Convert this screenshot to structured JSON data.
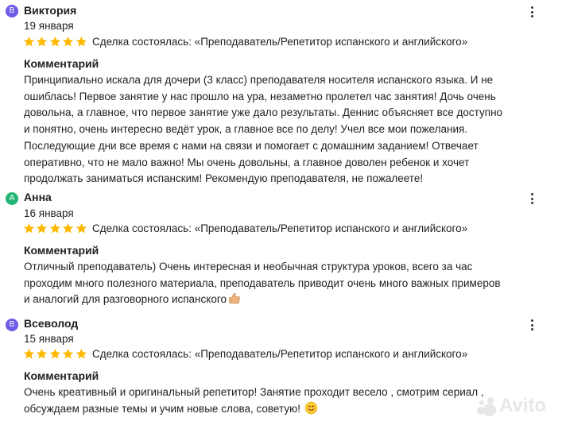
{
  "colors": {
    "star": "#ffb800",
    "avatar_purple": "#6c5ce7",
    "avatar_green": "#22b573"
  },
  "reviews": [
    {
      "initial": "В",
      "name": "Виктория",
      "date": "19 января",
      "rating": 5,
      "deal": "Сделка состоялась: «Преподаватель/Репетитор испанского и английского»",
      "comment_title": "Комментарий",
      "comment_lines": [
        "Принципиально искала для дочери (3 класс) преподавателя носителя испанского языка. И не",
        "ошиблась! Первое занятие у нас прошло на ура, незаметно пролетел час занятия! Дочь очень",
        "довольна, а главное, что первое занятие уже дало результаты. Деннис объясняет все доступно",
        "и понятно, очень интересно ведёт урок, а главное все по делу! Учел все мои пожелания.",
        "Последующие дни все время с нами на связи и помогает с домашним заданием! Отвечает",
        "оперативно, что не мало важно! Мы очень довольны, а главное доволен ребенок и хочет",
        "продолжать заниматься испанским! Рекомендую преподавателя, не пожалеете!"
      ]
    },
    {
      "initial": "А",
      "name": "Анна",
      "date": "16 января",
      "rating": 5,
      "deal": "Сделка состоялась: «Преподаватель/Репетитор испанского и английского»",
      "comment_title": "Комментарий",
      "comment_lines": [
        "Отличный преподаватель) Очень интересная и необычная структура уроков, всего за час",
        "проходим много полезного материала, преподаватель приводит очень много важных примеров",
        "и аналогий для разговорного испанского"
      ],
      "emoji": "👍🏼"
    },
    {
      "initial": "В",
      "name": "Всеволод",
      "date": "15 января",
      "rating": 5,
      "deal": "Сделка состоялась: «Преподаватель/Репетитор испанского и английского»",
      "comment_title": "Комментарий",
      "comment_lines": [
        "Очень креативный и оригинальный репетитор! Занятие проходит весело , смотрим сериал ,",
        "обсуждаем разные темы и учим новые слова, советую!"
      ],
      "emoji": "😊"
    }
  ],
  "watermark": "Avito"
}
